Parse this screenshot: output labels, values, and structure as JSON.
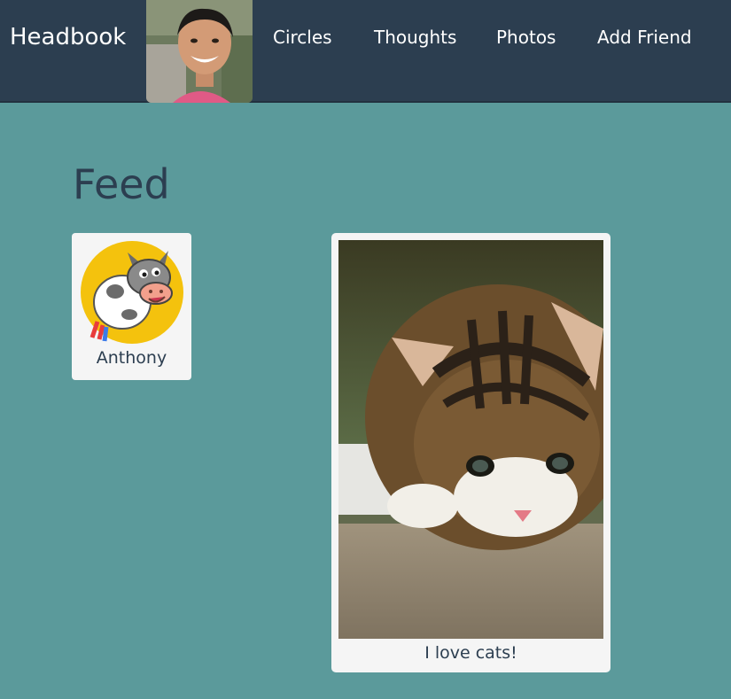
{
  "app": {
    "brand": "Headbook"
  },
  "nav": {
    "items": [
      {
        "label": "Circles"
      },
      {
        "label": "Thoughts"
      },
      {
        "label": "Photos"
      },
      {
        "label": "Add Friend"
      }
    ]
  },
  "page": {
    "title": "Feed"
  },
  "friends": [
    {
      "name": "Anthony"
    }
  ],
  "posts": [
    {
      "caption": "I love cats!"
    }
  ],
  "colors": {
    "navbar": "#2c3e50",
    "background": "#5b9a9b",
    "card": "#f5f5f5",
    "title_text": "#2c3e50"
  }
}
